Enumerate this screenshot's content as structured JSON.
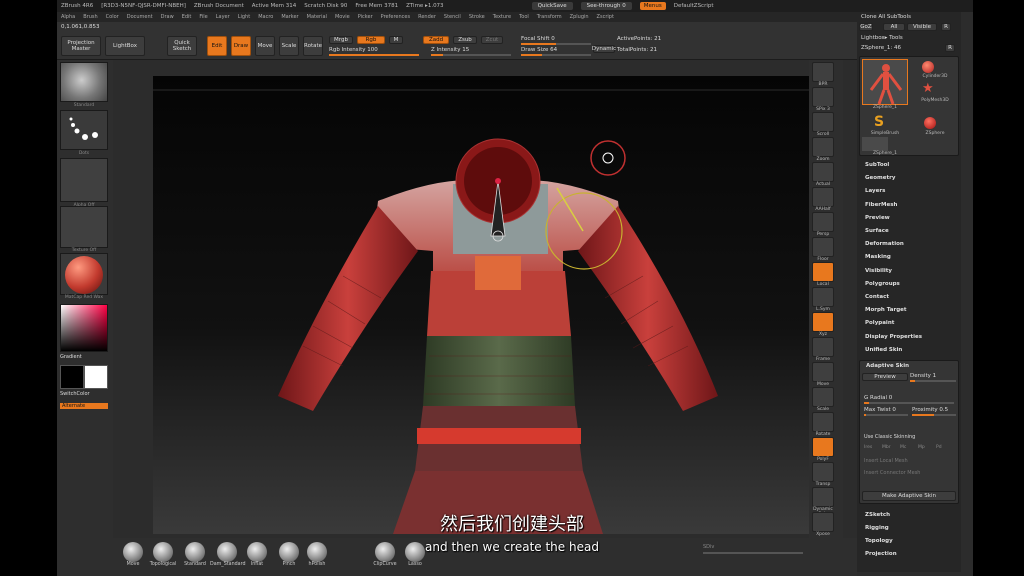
{
  "window": {
    "title": "ZBrush 4R6",
    "id": "[R3D3-N5NF-QJSR-DMFI-NBEH]",
    "document": "ZBrush Document",
    "active_mem": "Active Mem 314",
    "scratch": "Scratch Disk 90",
    "free_mem": "Free Mem 3781",
    "ztime": "ZTime ▸1.073",
    "quicksave": "QuickSave",
    "seethrough": "See-through 0",
    "menus": "Menus",
    "default_zscript": "DefaultZScript"
  },
  "menubar": [
    "Alpha",
    "Brush",
    "Color",
    "Document",
    "Draw",
    "Edit",
    "File",
    "Layer",
    "Light",
    "Macro",
    "Marker",
    "Material",
    "Movie",
    "Picker",
    "Preferences",
    "Render",
    "Stencil",
    "Stroke",
    "Texture",
    "Tool",
    "Transform",
    "Zplugin",
    "Zscript"
  ],
  "toolbar": {
    "coords": "0,1.061,0.853",
    "projection_master": "Projection Master",
    "lightbox": "LightBox",
    "quick_sketch": "Quick Sketch",
    "edit": "Edit",
    "draw": "Draw",
    "move": "Move",
    "scale": "Scale",
    "rotate": "Rotate",
    "mrgb": "Mrgb",
    "rgb": "Rgb",
    "m": "M",
    "zadd": "Zadd",
    "zsub": "Zsub",
    "zcut": "Zcut",
    "rgb_intensity": "Rgb Intensity 100",
    "z_intensity": "Z Intensity 15",
    "focal_shift": "Focal Shift 0",
    "draw_size": "Draw Size 64",
    "dynamic": "Dynamic",
    "active_points": "ActivePoints: 21",
    "total_points": "TotalPoints: 21"
  },
  "leftshelf": {
    "brush_label": "Standard",
    "stroke_label": "Dots",
    "alpha_label": "Alpha Off",
    "texture_label": "Texture Off",
    "material_label": "MatCap Red Wax",
    "gradient": "Gradient",
    "switchcolor": "SwitchColor",
    "alternate": "Alternate"
  },
  "rightshelf": [
    "BPR",
    "SPix 3",
    "Scroll",
    "Zoom",
    "Actual",
    "AAHalf",
    "Persp",
    "Floor",
    "Local",
    "L.Sym",
    "Xyz",
    "Frame",
    "Move",
    "Scale",
    "Rotate",
    "PolyF",
    "Transp",
    "Dynamic Solo",
    "Xpose"
  ],
  "rightpanel": {
    "clone_all": "Clone All SubTools",
    "goz": "GoZ",
    "all": "All",
    "visible": "Visible",
    "r": "R",
    "lightbox_tools": "Lightbox▸ Tools",
    "zsphere_name": "ZSphere_1: 46",
    "tools": [
      "ZSphere_1",
      "Cylinder3D",
      "PolyMesh3D",
      "SimpleBrush",
      "ZSphere",
      "ZSphere_1"
    ],
    "menu": [
      "SubTool",
      "Geometry",
      "Layers",
      "FiberMesh",
      "Preview",
      "Surface",
      "Deformation",
      "Masking",
      "Visibility",
      "Polygroups",
      "Contact",
      "Morph Target",
      "Polypaint",
      "Display Properties",
      "Unified Skin"
    ],
    "adaptive_skin": "Adaptive Skin",
    "preview": "Preview",
    "density": "Density 1",
    "g_radial": "G Radial 0",
    "max_twist": "Max Twist 0",
    "proximity": "Proximity 0.5",
    "use_classic": "Use Classic Skinning",
    "ir_row": [
      "Ires",
      "Mbr",
      "Mc",
      "Mp",
      "Pd"
    ],
    "insert_local": "Insert Local Mesh",
    "insert_connector": "Insert Connector Mesh",
    "make_adaptive": "Make Adaptive Skin",
    "menu2": [
      "ZSketch",
      "Rigging",
      "Topology",
      "Projection"
    ]
  },
  "bottombar": {
    "brushes": [
      "Move",
      "Topological",
      "Standard",
      "Dam_Standard",
      "Inflat",
      "Pinch",
      "hPolish",
      "ClipCurve",
      "Lasso"
    ],
    "sdiv": "SDiv"
  },
  "subtitles": {
    "chinese": "然后我们创建头部",
    "english": "and then we create the head"
  },
  "colors": {
    "accent": "#e8781e",
    "body_red": "#c33a3a",
    "panel": "#2c2c2c"
  }
}
